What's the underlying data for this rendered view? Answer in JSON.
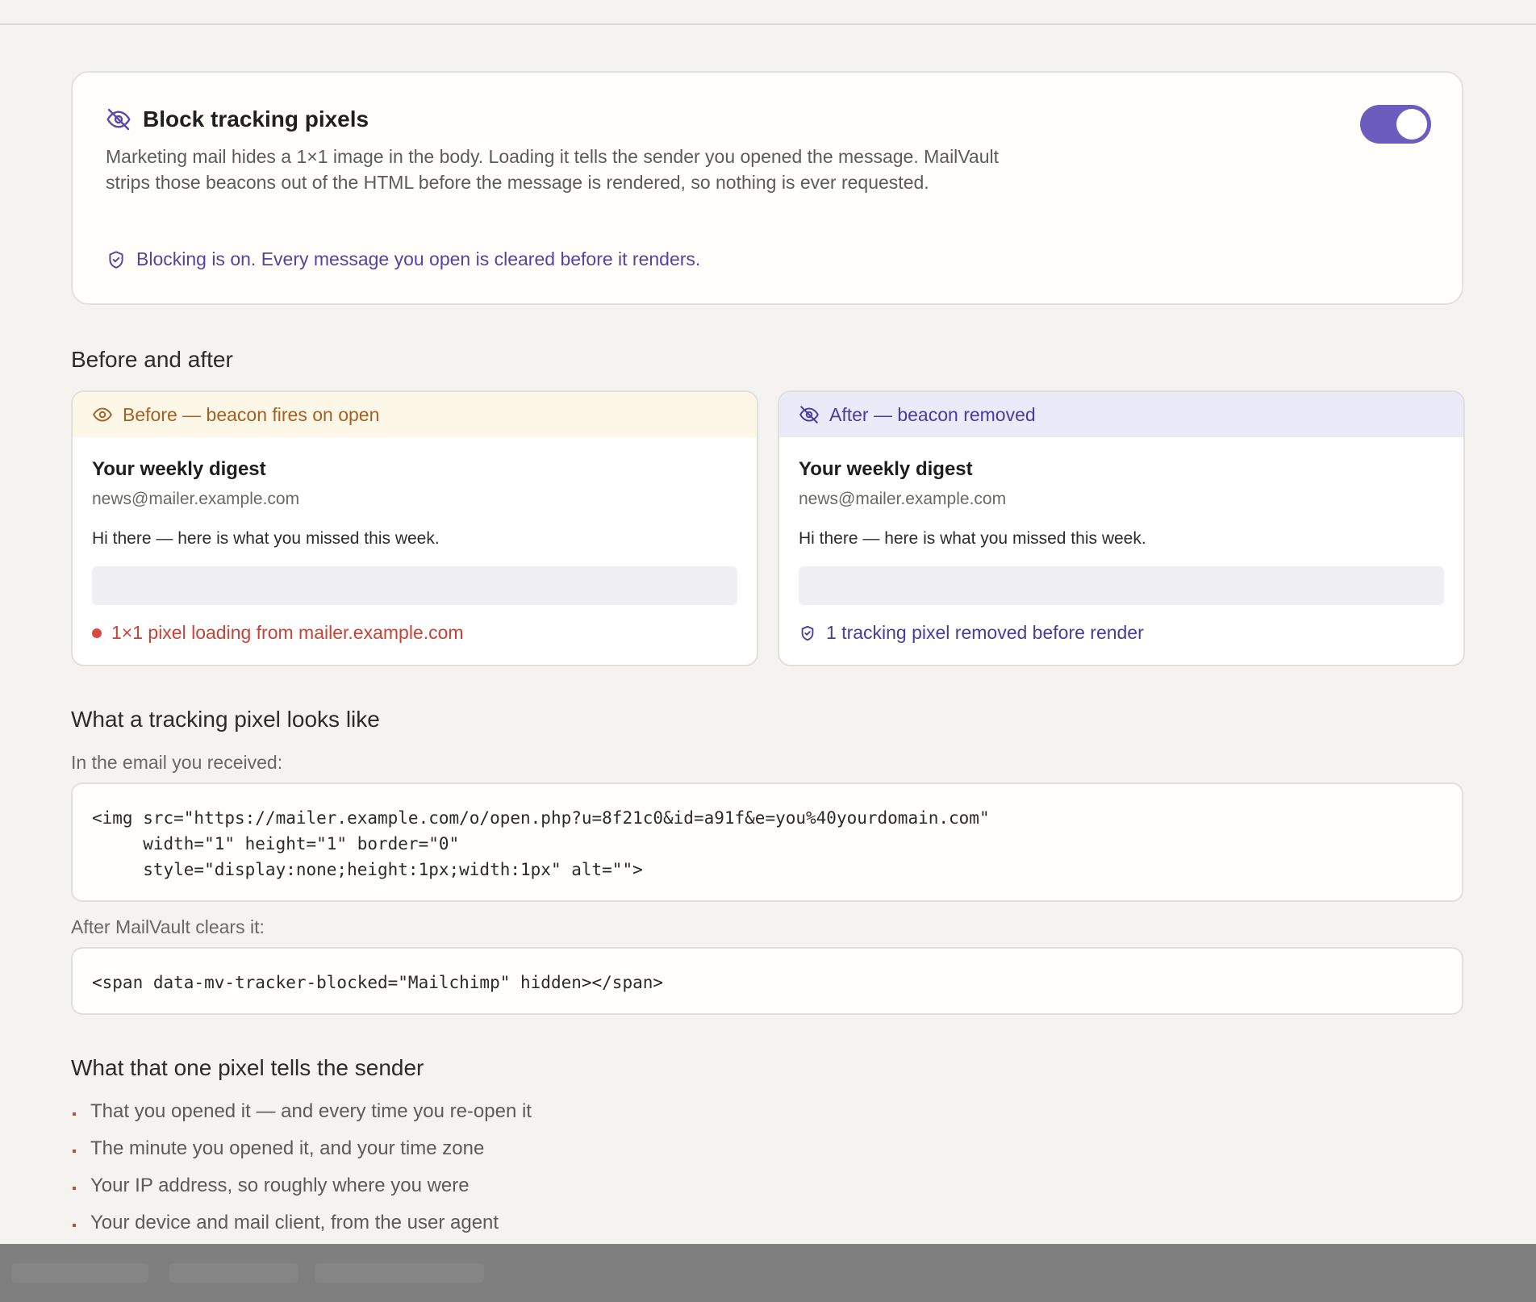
{
  "toggle_card": {
    "title": "Block tracking pixels",
    "description": "Marketing mail hides a 1×1 image in the body. Loading it tells the sender you opened the message. MailVault strips those beacons out of the HTML before the message is rendered, so nothing is ever requested.",
    "status": "Blocking is on. Every message you open is cleared before it renders.",
    "toggle_on": true,
    "title_icon": "eye-off-icon",
    "status_icon": "shield-check-icon"
  },
  "before_after": {
    "heading": "Before and after",
    "before": {
      "label": "Before — beacon fires on open",
      "icon": "eye-icon",
      "subject": "Your weekly digest",
      "from": "news@mailer.example.com",
      "body": "Hi there — here is what you missed this week.",
      "note": "1×1 pixel loading from mailer.example.com"
    },
    "after": {
      "label": "After — beacon removed",
      "icon": "eye-off-icon",
      "subject": "Your weekly digest",
      "from": "news@mailer.example.com",
      "body": "Hi there — here is what you missed this week.",
      "note": "1 tracking pixel removed before render",
      "note_icon": "shield-check-icon"
    }
  },
  "pixel_example": {
    "heading": "What a tracking pixel looks like",
    "received_caption": "In the email you received:",
    "received_code": "<img src=\"https://mailer.example.com/o/open.php?u=8f21c0&id=a91f&e=you%40yourdomain.com\"\n     width=\"1\" height=\"1\" border=\"0\"\n     style=\"display:none;height:1px;width:1px\" alt=\"\">",
    "cleared_caption": "After MailVault clears it:",
    "cleared_code": "<span data-mv-tracker-blocked=\"Mailchimp\" hidden></span>"
  },
  "tells": {
    "heading": "What that one pixel tells the sender",
    "items": [
      "That you opened it — and every time you re-open it",
      "The minute you opened it, and your time zone",
      "Your IP address, so roughly where you were",
      "Your device and mail client, from the user agent"
    ]
  },
  "colors": {
    "accent": "#6c5cbd",
    "before_tint": "#fdf7e8",
    "after_tint": "#ebeaf8",
    "warning_red": "#c84236"
  }
}
